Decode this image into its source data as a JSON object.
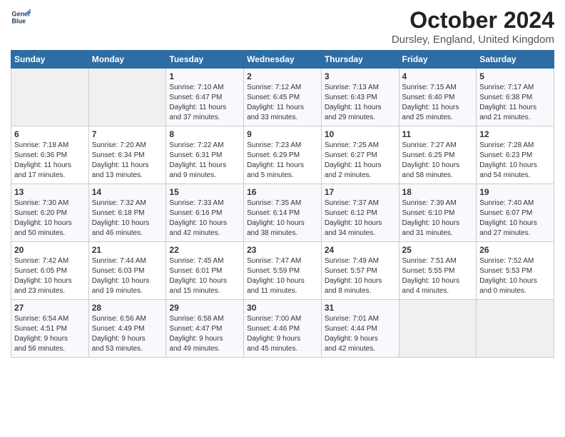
{
  "header": {
    "logo_line1": "General",
    "logo_line2": "Blue",
    "month": "October 2024",
    "location": "Dursley, England, United Kingdom"
  },
  "days_of_week": [
    "Sunday",
    "Monday",
    "Tuesday",
    "Wednesday",
    "Thursday",
    "Friday",
    "Saturday"
  ],
  "weeks": [
    [
      {
        "day": "",
        "content": ""
      },
      {
        "day": "",
        "content": ""
      },
      {
        "day": "1",
        "content": "Sunrise: 7:10 AM\nSunset: 6:47 PM\nDaylight: 11 hours\nand 37 minutes."
      },
      {
        "day": "2",
        "content": "Sunrise: 7:12 AM\nSunset: 6:45 PM\nDaylight: 11 hours\nand 33 minutes."
      },
      {
        "day": "3",
        "content": "Sunrise: 7:13 AM\nSunset: 6:43 PM\nDaylight: 11 hours\nand 29 minutes."
      },
      {
        "day": "4",
        "content": "Sunrise: 7:15 AM\nSunset: 6:40 PM\nDaylight: 11 hours\nand 25 minutes."
      },
      {
        "day": "5",
        "content": "Sunrise: 7:17 AM\nSunset: 6:38 PM\nDaylight: 11 hours\nand 21 minutes."
      }
    ],
    [
      {
        "day": "6",
        "content": "Sunrise: 7:18 AM\nSunset: 6:36 PM\nDaylight: 11 hours\nand 17 minutes."
      },
      {
        "day": "7",
        "content": "Sunrise: 7:20 AM\nSunset: 6:34 PM\nDaylight: 11 hours\nand 13 minutes."
      },
      {
        "day": "8",
        "content": "Sunrise: 7:22 AM\nSunset: 6:31 PM\nDaylight: 11 hours\nand 9 minutes."
      },
      {
        "day": "9",
        "content": "Sunrise: 7:23 AM\nSunset: 6:29 PM\nDaylight: 11 hours\nand 5 minutes."
      },
      {
        "day": "10",
        "content": "Sunrise: 7:25 AM\nSunset: 6:27 PM\nDaylight: 11 hours\nand 2 minutes."
      },
      {
        "day": "11",
        "content": "Sunrise: 7:27 AM\nSunset: 6:25 PM\nDaylight: 10 hours\nand 58 minutes."
      },
      {
        "day": "12",
        "content": "Sunrise: 7:28 AM\nSunset: 6:23 PM\nDaylight: 10 hours\nand 54 minutes."
      }
    ],
    [
      {
        "day": "13",
        "content": "Sunrise: 7:30 AM\nSunset: 6:20 PM\nDaylight: 10 hours\nand 50 minutes."
      },
      {
        "day": "14",
        "content": "Sunrise: 7:32 AM\nSunset: 6:18 PM\nDaylight: 10 hours\nand 46 minutes."
      },
      {
        "day": "15",
        "content": "Sunrise: 7:33 AM\nSunset: 6:16 PM\nDaylight: 10 hours\nand 42 minutes."
      },
      {
        "day": "16",
        "content": "Sunrise: 7:35 AM\nSunset: 6:14 PM\nDaylight: 10 hours\nand 38 minutes."
      },
      {
        "day": "17",
        "content": "Sunrise: 7:37 AM\nSunset: 6:12 PM\nDaylight: 10 hours\nand 34 minutes."
      },
      {
        "day": "18",
        "content": "Sunrise: 7:39 AM\nSunset: 6:10 PM\nDaylight: 10 hours\nand 31 minutes."
      },
      {
        "day": "19",
        "content": "Sunrise: 7:40 AM\nSunset: 6:07 PM\nDaylight: 10 hours\nand 27 minutes."
      }
    ],
    [
      {
        "day": "20",
        "content": "Sunrise: 7:42 AM\nSunset: 6:05 PM\nDaylight: 10 hours\nand 23 minutes."
      },
      {
        "day": "21",
        "content": "Sunrise: 7:44 AM\nSunset: 6:03 PM\nDaylight: 10 hours\nand 19 minutes."
      },
      {
        "day": "22",
        "content": "Sunrise: 7:45 AM\nSunset: 6:01 PM\nDaylight: 10 hours\nand 15 minutes."
      },
      {
        "day": "23",
        "content": "Sunrise: 7:47 AM\nSunset: 5:59 PM\nDaylight: 10 hours\nand 11 minutes."
      },
      {
        "day": "24",
        "content": "Sunrise: 7:49 AM\nSunset: 5:57 PM\nDaylight: 10 hours\nand 8 minutes."
      },
      {
        "day": "25",
        "content": "Sunrise: 7:51 AM\nSunset: 5:55 PM\nDaylight: 10 hours\nand 4 minutes."
      },
      {
        "day": "26",
        "content": "Sunrise: 7:52 AM\nSunset: 5:53 PM\nDaylight: 10 hours\nand 0 minutes."
      }
    ],
    [
      {
        "day": "27",
        "content": "Sunrise: 6:54 AM\nSunset: 4:51 PM\nDaylight: 9 hours\nand 56 minutes."
      },
      {
        "day": "28",
        "content": "Sunrise: 6:56 AM\nSunset: 4:49 PM\nDaylight: 9 hours\nand 53 minutes."
      },
      {
        "day": "29",
        "content": "Sunrise: 6:58 AM\nSunset: 4:47 PM\nDaylight: 9 hours\nand 49 minutes."
      },
      {
        "day": "30",
        "content": "Sunrise: 7:00 AM\nSunset: 4:46 PM\nDaylight: 9 hours\nand 45 minutes."
      },
      {
        "day": "31",
        "content": "Sunrise: 7:01 AM\nSunset: 4:44 PM\nDaylight: 9 hours\nand 42 minutes."
      },
      {
        "day": "",
        "content": ""
      },
      {
        "day": "",
        "content": ""
      }
    ]
  ]
}
